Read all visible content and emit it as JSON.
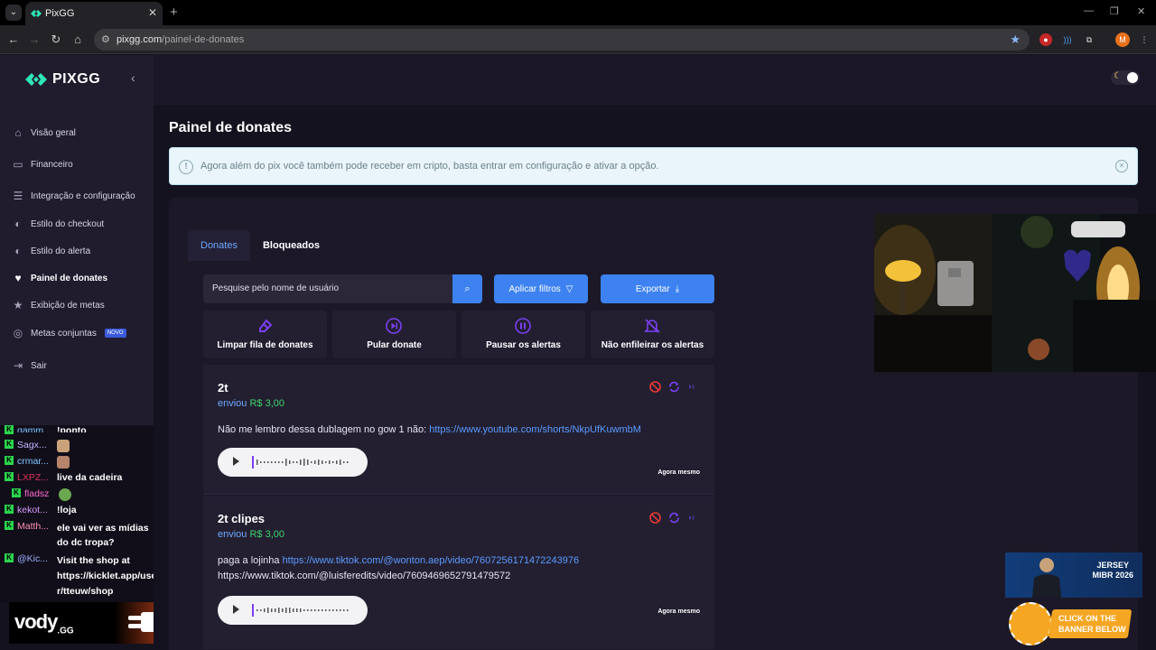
{
  "browser": {
    "tab_title": "PixGG",
    "url_domain": "pixgg.com",
    "url_path": "/painel-de-donates",
    "profile_initial": "M"
  },
  "sidebar": {
    "brand": "PIXGG",
    "items": [
      {
        "label": "Visão geral",
        "icon": "home-icon"
      },
      {
        "label": "Financeiro",
        "icon": "wallet-icon"
      },
      {
        "label": "Integração e configuração",
        "icon": "settings-icon"
      },
      {
        "label": "Estilo do checkout",
        "icon": "palette-icon"
      },
      {
        "label": "Estilo do alerta",
        "icon": "palette-icon"
      },
      {
        "label": "Painel de donates",
        "icon": "hand-heart-icon",
        "active": true
      },
      {
        "label": "Exibição de metas",
        "icon": "star-icon"
      },
      {
        "label": "Metas conjuntas",
        "icon": "target-icon",
        "badge": "NOVO"
      },
      {
        "label": "Sair",
        "icon": "logout-icon"
      }
    ]
  },
  "chat": [
    {
      "user": "gamm...",
      "msg": "!ponto",
      "color": "#7ec8ff"
    },
    {
      "user": "Sagx...",
      "msg": "",
      "color": "#c7b3ff"
    },
    {
      "user": "crmar...",
      "msg": "",
      "color": "#7ec8ff"
    },
    {
      "user": "LXPZ...",
      "msg": "live da cadeira",
      "color": "#e0305a"
    },
    {
      "user": "fladsz",
      "msg": "",
      "color": "#ff6bd1"
    },
    {
      "user": "kekot...",
      "msg": "!loja",
      "color": "#d99bff"
    },
    {
      "user": "Matth...",
      "msg": "ele vai ver as mídias",
      "msg2": "do dc tropa?",
      "color": "#ff8fb3"
    },
    {
      "user": "@Kic...",
      "msg": "Visit the shop at",
      "msg2": "https://kicklet.app/use",
      "msg3": "r/tteuw/shop",
      "color": "#9bb0ff"
    }
  ],
  "vody": {
    "brand": "vody",
    "suffix": ".GG"
  },
  "page": {
    "title": "Painel de donates",
    "alert": "Agora além do pix você também pode receber em cripto, basta entrar em configuração e ativar a opção."
  },
  "tabs": [
    "Donates",
    "Bloqueados"
  ],
  "search": {
    "placeholder": "Pesquise pelo nome de usuário"
  },
  "buttons": {
    "filters": "Aplicar filtros",
    "export": "Exportar"
  },
  "actions": [
    {
      "label": "Limpar fila de donates",
      "icon": "eraser-icon"
    },
    {
      "label": "Pular donate",
      "icon": "skip-icon"
    },
    {
      "label": "Pausar os alertas",
      "icon": "pause-icon"
    },
    {
      "label": "Não enfileirar os alertas",
      "icon": "bell-off-icon"
    }
  ],
  "donations": [
    {
      "name": "2t",
      "sent": "enviou",
      "amount": "R$ 3,00",
      "msg_prefix": "Não me lembro dessa dublagem no gow 1 não: ",
      "link1": "https://www.youtube.com/shorts/NkpUfKuwmbM",
      "time": "Agora mesmo"
    },
    {
      "name": "2t clipes",
      "sent": "enviou",
      "amount": "R$ 3,00",
      "msg_prefix": "paga a lojinha ",
      "link1": "https://www.tiktok.com/@wonton.aep/video/7607256171472243976",
      "line2": "https://www.tiktok.com/@luisferedits/video/7609469652791479572",
      "time": "Agora mesmo"
    }
  ],
  "ad": {
    "line1": "JERSEY",
    "line2": "MIBR 2026",
    "cta1": "CLICK ON THE",
    "cta2": "BANNER BELOW"
  },
  "colors": {
    "accent": "#3d82f0",
    "purple": "#7b3ff2",
    "amount": "#3fd46b",
    "link": "#5b9bff"
  }
}
